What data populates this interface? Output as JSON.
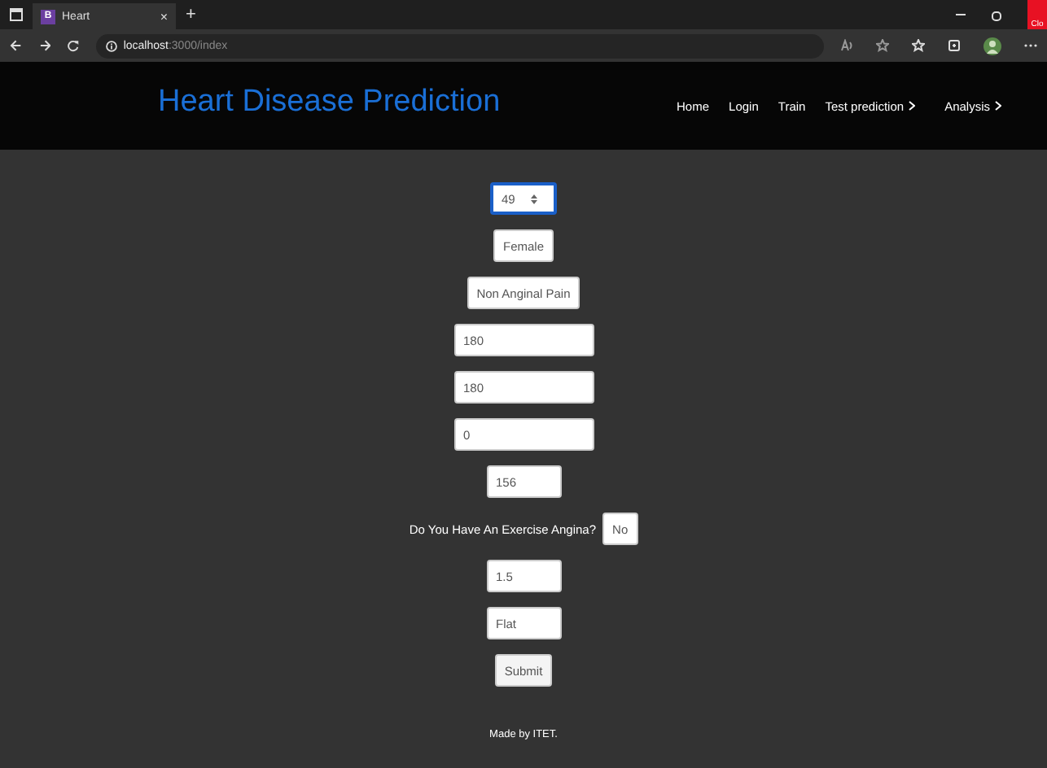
{
  "browser": {
    "tab_icon": "B",
    "tab_title": "Heart",
    "tab_close": "×",
    "new_tab": "+",
    "url_host": "localhost",
    "url_path": ":3000/index",
    "close_tooltip": "Clo"
  },
  "navbar": {
    "brand": "Heart Disease Prediction",
    "links": [
      {
        "label": "Home",
        "dropdown": false
      },
      {
        "label": "Login",
        "dropdown": false
      },
      {
        "label": "Train",
        "dropdown": false
      },
      {
        "label": "Test prediction",
        "dropdown": true
      },
      {
        "label": "Analysis",
        "dropdown": true
      }
    ]
  },
  "form": {
    "fields": [
      {
        "kind": "spinner",
        "value": "49",
        "focused": true
      },
      {
        "kind": "select",
        "value": "Female"
      },
      {
        "kind": "select",
        "value": "Non Anginal Pain"
      },
      {
        "kind": "textbox",
        "value": "180"
      },
      {
        "kind": "textbox",
        "value": "180"
      },
      {
        "kind": "textbox",
        "value": "0"
      },
      {
        "kind": "input",
        "value": "156"
      },
      {
        "kind": "labeled-select",
        "label": "Do You Have An Exercise Angina?",
        "value": "No"
      },
      {
        "kind": "input",
        "value": "1.5"
      },
      {
        "kind": "input",
        "value": "Flat"
      }
    ],
    "submit": "Submit"
  },
  "footer": "Made by ITET."
}
